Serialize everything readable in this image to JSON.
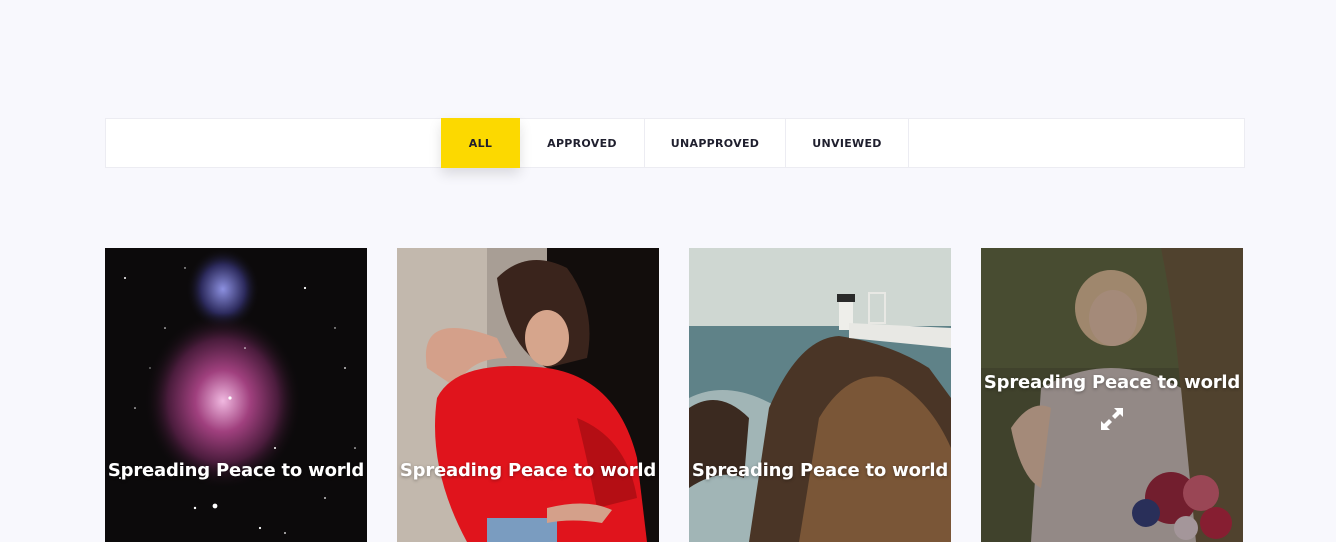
{
  "filters": {
    "tabs": [
      {
        "label": "ALL",
        "active": true
      },
      {
        "label": "APPROVED",
        "active": false
      },
      {
        "label": "UNAPPROVED",
        "active": false
      },
      {
        "label": "UNVIEWED",
        "active": false
      }
    ]
  },
  "colors": {
    "accent": "#fcd900",
    "page_background": "#f8f8fd"
  },
  "gallery": {
    "items": [
      {
        "title": "Spreading Peace to world",
        "image": "orion-nebula"
      },
      {
        "title": "Spreading Peace to world",
        "image": "woman-red-top"
      },
      {
        "title": "Spreading Peace to world",
        "image": "lighthouse-cliff"
      },
      {
        "title": "Spreading Peace to world",
        "image": "bride-with-flowers",
        "hovered": true,
        "icon": "expand-icon"
      }
    ]
  }
}
